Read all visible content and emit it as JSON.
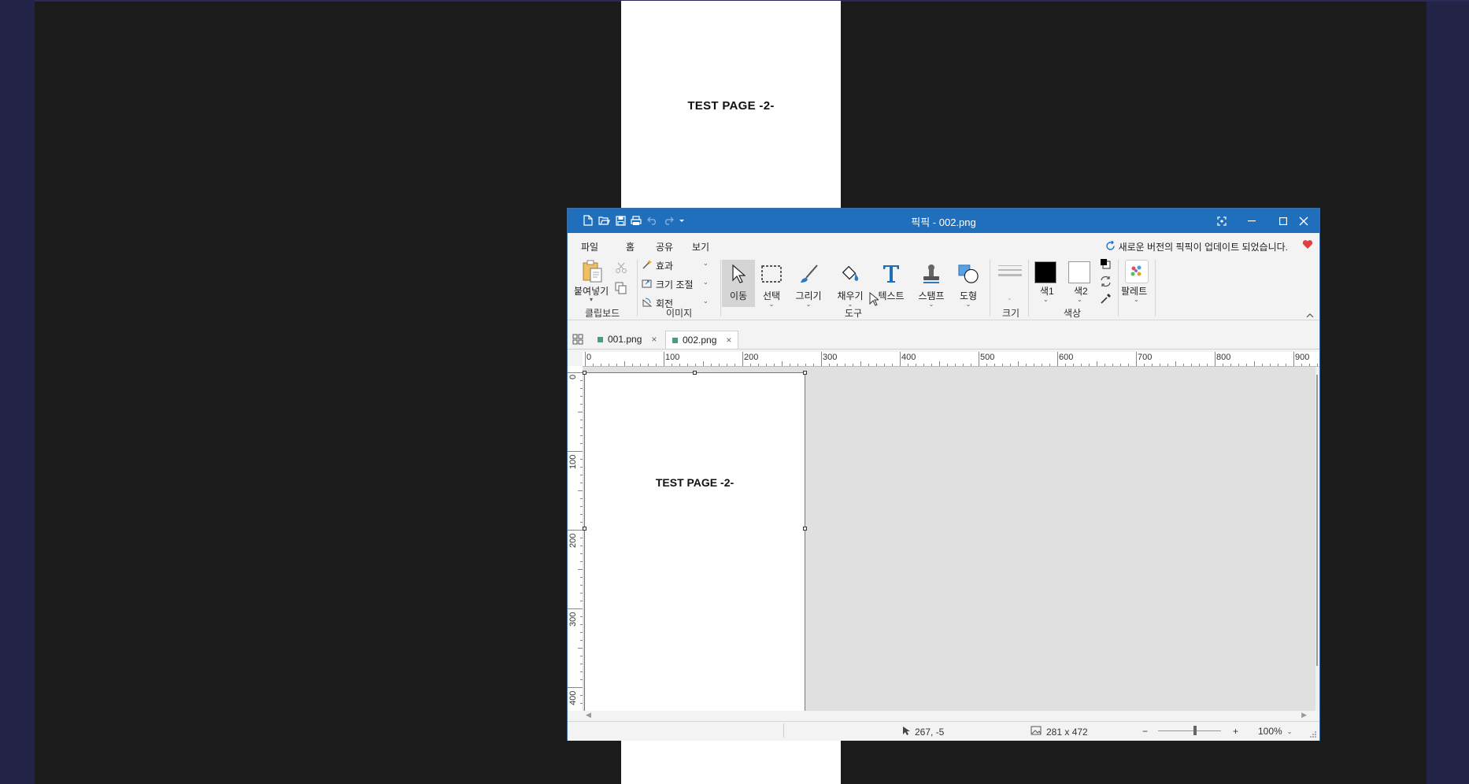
{
  "background": {
    "page_text": "TEST PAGE -2-"
  },
  "window": {
    "title": "픽픽 - 002.png",
    "menus": [
      "파일",
      "홈",
      "공유",
      "보기"
    ],
    "update_notice": "새로운 버전의 픽픽이 업데이트 되었습니다."
  },
  "ribbon": {
    "clipboard": {
      "paste_label": "붙여넣기",
      "group_label": "클립보드"
    },
    "image": {
      "effects_label": "효과",
      "resize_label": "크기 조절",
      "rotate_label": "회전",
      "group_label": "이미지"
    },
    "tools": {
      "move_label": "이동",
      "select_label": "선택",
      "draw_label": "그리기",
      "fill_label": "채우기",
      "text_label": "텍스트",
      "stamp_label": "스탬프",
      "shape_label": "도형",
      "group_label": "도구"
    },
    "size": {
      "group_label": "크기"
    },
    "colors": {
      "color1_label": "색1",
      "color2_label": "색2",
      "group_label": "색상",
      "color1_value": "#000000",
      "color2_value": "#ffffff"
    },
    "palette": {
      "label": "팔레트"
    }
  },
  "tabs": [
    {
      "label": "001.png"
    },
    {
      "label": "002.png"
    }
  ],
  "ruler": {
    "h_labels": [
      "0",
      "100",
      "200",
      "300",
      "400",
      "500",
      "600",
      "700",
      "800",
      "900"
    ],
    "v_labels": [
      "0",
      "100",
      "200",
      "300",
      "400"
    ]
  },
  "canvas": {
    "image_text": "TEST PAGE -2-"
  },
  "status": {
    "cursor_pos": "267, -5",
    "image_size": "281 x 472",
    "zoom": "100%"
  },
  "colors": {
    "titlebar": "#1f6fbd",
    "canvas_bg": "#e0e0e0",
    "accent_tab": "#4c9c7a"
  }
}
